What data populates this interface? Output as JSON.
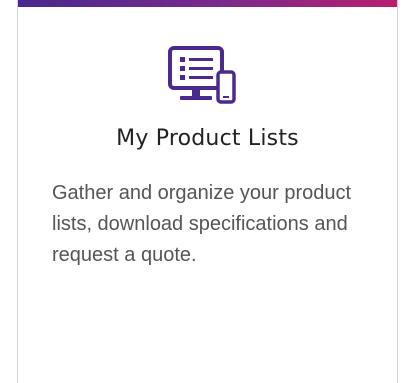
{
  "card": {
    "title": "My Product Lists",
    "description": "Gather and organize your product lists, download specifications and request a quote.",
    "icon": "product-list-devices-icon",
    "accent_color": "#4a2a8e",
    "accent_gradient_end": "#b81f6e"
  }
}
